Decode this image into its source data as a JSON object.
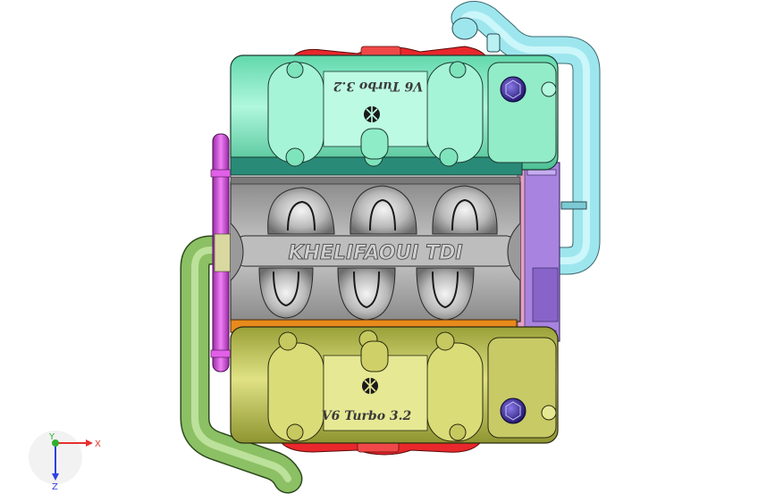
{
  "viewport": {
    "background": "#ffffff"
  },
  "engine": {
    "top_cover_label": "V6 Turbo 3.2",
    "bottom_cover_label": "V6 Turbo 3.2",
    "block_label": "KHELIFAOUI TDI",
    "colors": {
      "top_cover": "#8ff0c8",
      "bottom_cover": "#c8c85a",
      "block": "#a9a9a9",
      "pipe_cyan": "#9ee6ee",
      "pipe_green": "#8cc064",
      "pipe_magenta": "#d040d8",
      "gasket_red": "#e8282c",
      "gasket_orange": "#e88a1c",
      "side_purple": "#a884e0",
      "cap_blue": "#3a2a9a"
    }
  },
  "triad": {
    "x_label": "X",
    "y_label": "Y",
    "z_label": "Z",
    "x_color": "#e83030",
    "y_color": "#30b030",
    "z_color": "#3040e0"
  }
}
